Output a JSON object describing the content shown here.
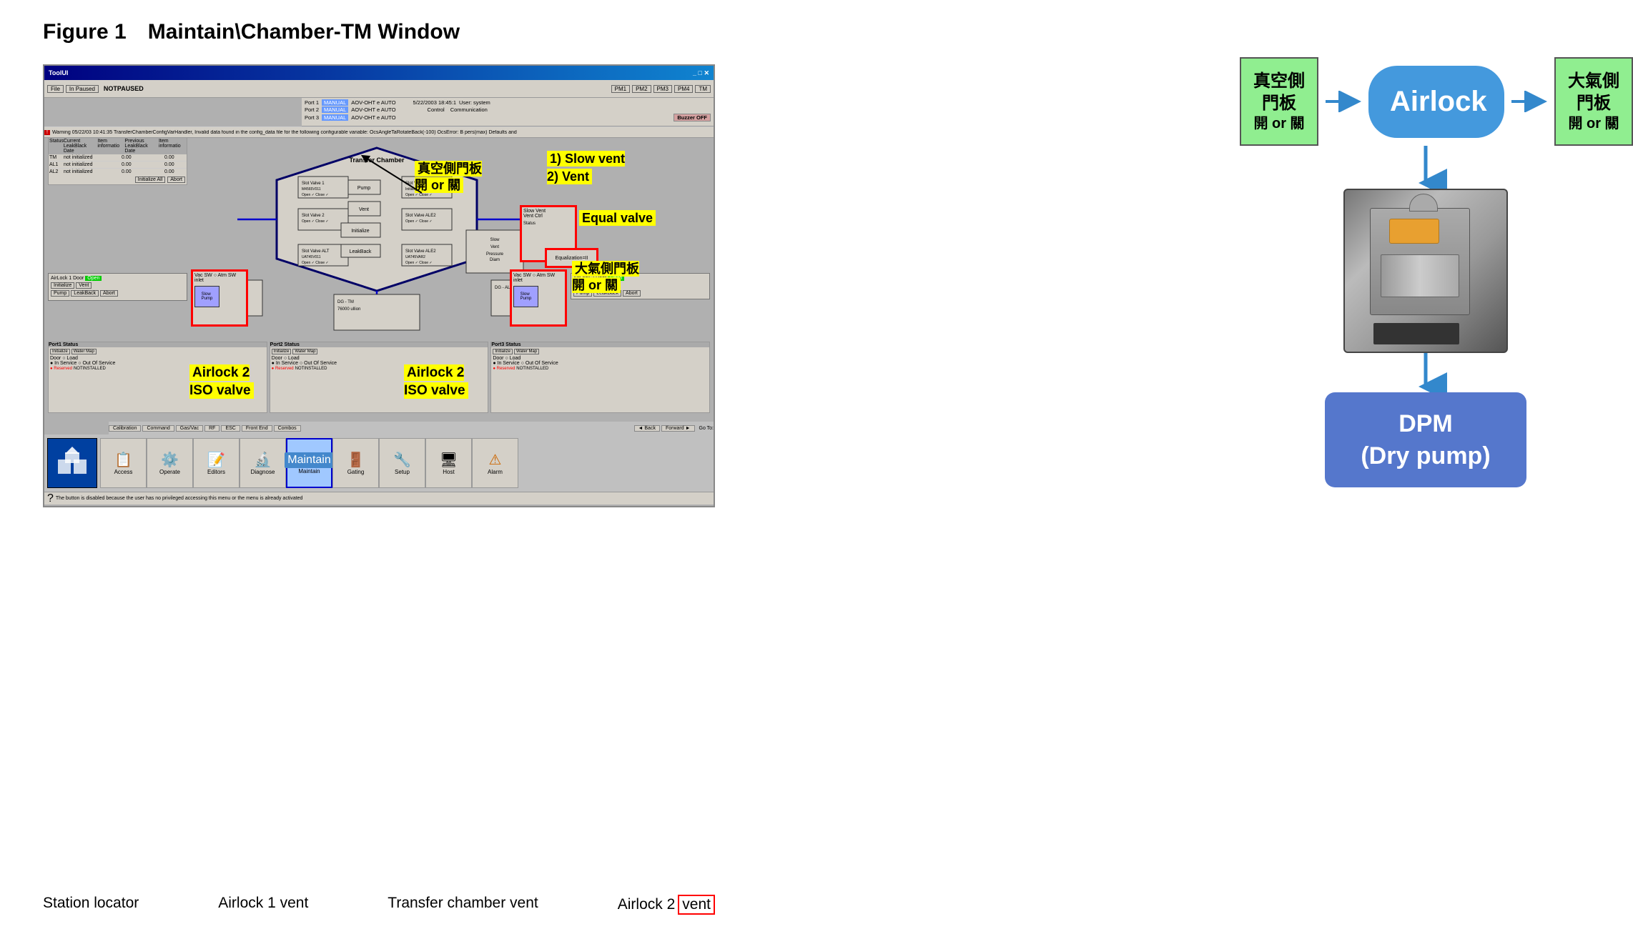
{
  "page": {
    "title": "Figure 1",
    "subtitle": "Maintain\\Chamber-TM Window"
  },
  "screenshot": {
    "title_bar": "ToolUI",
    "toolbar": {
      "buttons": [
        "File",
        "In Paused",
        "NOTPAUSED",
        "PM1",
        "PM2",
        "PM3",
        "PM4",
        "TM"
      ]
    },
    "ports": [
      {
        "label": "Port 1",
        "mode": "MANUAL",
        "aov": "AOV-OHT e AUTO"
      },
      {
        "label": "Port 2",
        "mode": "MANUAL",
        "aov": "AOV-OHT e AUTO"
      },
      {
        "label": "Port 3",
        "mode": "MANUAL",
        "aov": "AOV-OHT e AUTO"
      }
    ],
    "datetime": "5/22/2003 18:45:1",
    "user": "system",
    "buzzer": "Buzzer OFF",
    "warning": "Warning 05/22/03 10:41:35 TransferChamberConfigVarHandler, Invalid data found in the config_data file for the following configurable variable: OcsAngleTaRotateBack(-100) OcsError: B pers(max) Defaults and",
    "status": {
      "tm": "not initialized",
      "al1": "not initialized",
      "al2": "not initialized"
    },
    "buttons_bottom_tabs": [
      "Calibration",
      "Command",
      "Gas/Vac",
      "RF",
      "ESC",
      "Front End",
      "Combos"
    ],
    "bottom_icons": [
      "Access",
      "Operate",
      "Editors",
      "Diagnose",
      "Maintain",
      "Gating",
      "Setup",
      "Host",
      "Alarm"
    ],
    "bottom_note": "The button is disabled because the user has no privileged accessing this menu or the menu is already activated"
  },
  "annotations": {
    "vacuum_door_label": "真空側門板",
    "vacuum_door_sublabel": "開 or 關",
    "atmo_door_label": "大氣側門板",
    "atmo_door_sublabel": "開 or 關",
    "slow_vent": "1) Slow vent\n2) Vent",
    "equal_valve": "Equal valve",
    "atmo_door_ann": "大氣側門板\n開 or 關",
    "airlock2_iso1": "Airlock 2\nISO valve",
    "airlock2_iso2": "Airlock 2\nISO valve"
  },
  "bottom_labels": {
    "station_locator": "Station locator",
    "airlock1_vent": "Airlock 1 vent",
    "transfer_chamber_vent": "Transfer chamber vent",
    "airlock2_vent": "Airlock 2 vent"
  },
  "right_diagram": {
    "vacuum_box": {
      "line1": "真空側",
      "line2": "門板",
      "line3": "開 or 關"
    },
    "airlock_label": "Airlock",
    "atmo_box": {
      "line1": "大氣側",
      "line2": "門板",
      "line3": "開 or 關"
    },
    "dpm_label": "DPM\n(Dry pump)"
  },
  "colors": {
    "green_box_bg": "#90ee90",
    "blue_arrow": "#3388cc",
    "airlock_blue": "#4499dd",
    "dpm_blue": "#5577cc",
    "yellow_ann": "#ffff00"
  }
}
